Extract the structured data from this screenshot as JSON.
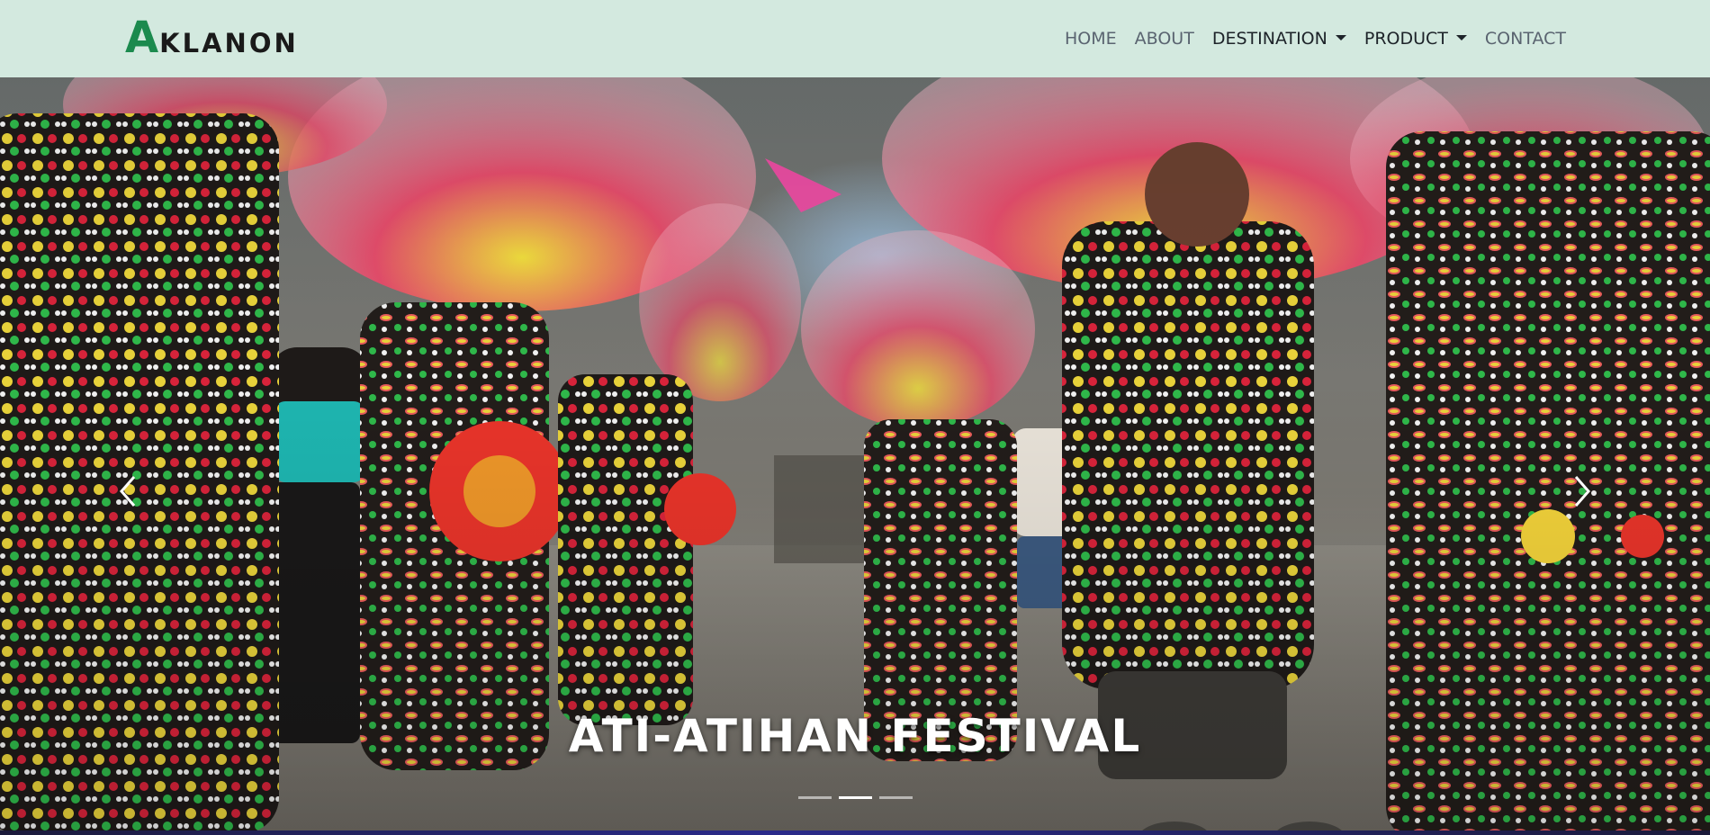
{
  "brand": {
    "initial": "A",
    "rest": "KLANON"
  },
  "nav": {
    "items": [
      {
        "label": "HOME",
        "dropdown": false
      },
      {
        "label": "ABOUT",
        "dropdown": false
      },
      {
        "label": "DESTINATION",
        "dropdown": true
      },
      {
        "label": "PRODUCT",
        "dropdown": true
      },
      {
        "label": "CONTACT",
        "dropdown": false
      }
    ]
  },
  "carousel": {
    "caption": "ATI-ATIHAN FESTIVAL",
    "slide_count": 3,
    "active_slide": 2,
    "prev_icon": "chevron-left-icon",
    "next_icon": "chevron-right-icon"
  },
  "colors": {
    "navbar_bg": "#d3e9df",
    "brand_accent": "#1b8a4e",
    "nav_text": "#5a6470",
    "nav_text_dark": "#1d2329"
  }
}
